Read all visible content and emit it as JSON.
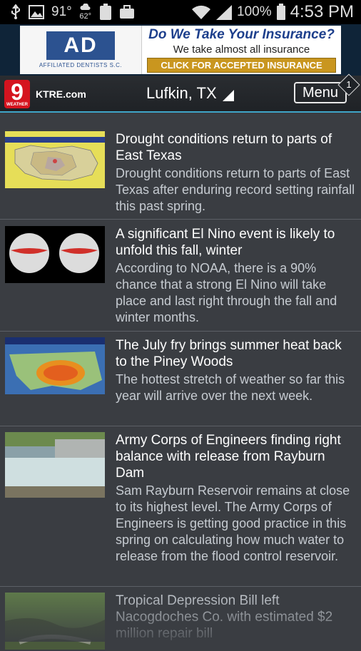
{
  "status_bar": {
    "icons_left": [
      "usb-icon",
      "image-icon"
    ],
    "temp_main": "91°",
    "temp_small": "62°",
    "battery_small": "100",
    "battery_pct": "100%",
    "time": "4:53 PM"
  },
  "ad": {
    "logo_mark": "AD",
    "logo_text": "AFFILIATED DENTISTS S.C.",
    "headline": "Do We Take Your Insurance?",
    "subline": "We take almost all insurance",
    "cta": "CLICK FOR ACCEPTED INSURANCE"
  },
  "header": {
    "logo_number": "9",
    "logo_sub": "WEATHER",
    "station": "KTRE.com",
    "location": "Lufkin, TX",
    "menu_label": "Menu",
    "menu_badge": "1"
  },
  "articles": [
    {
      "title": "Drought conditions return to parts of East Texas",
      "desc": "Drought conditions return to parts of East Texas after enduring record setting rainfall this past spring."
    },
    {
      "title": "A significant El Nino event is likely to unfold this fall, winter",
      "desc": "According to NOAA, there is a 90% chance that a strong El Nino will take place and last right through the fall and winter months."
    },
    {
      "title": "The July fry brings summer heat back to the Piney Woods",
      "desc": "The hottest stretch of weather so far this year will arrive over the next week."
    },
    {
      "title": "Army Corps of Engineers finding right balance with release from Rayburn Dam",
      "desc": "Sam Rayburn Reservoir remains at close to its highest level. The Army Corps of Engineers is getting good practice in this spring on calculating how much water to release from the flood control reservoir."
    },
    {
      "title": "Tropical Depression Bill left Nacogdoches Co. with estimated $2 million repair bill",
      "desc": ""
    }
  ]
}
